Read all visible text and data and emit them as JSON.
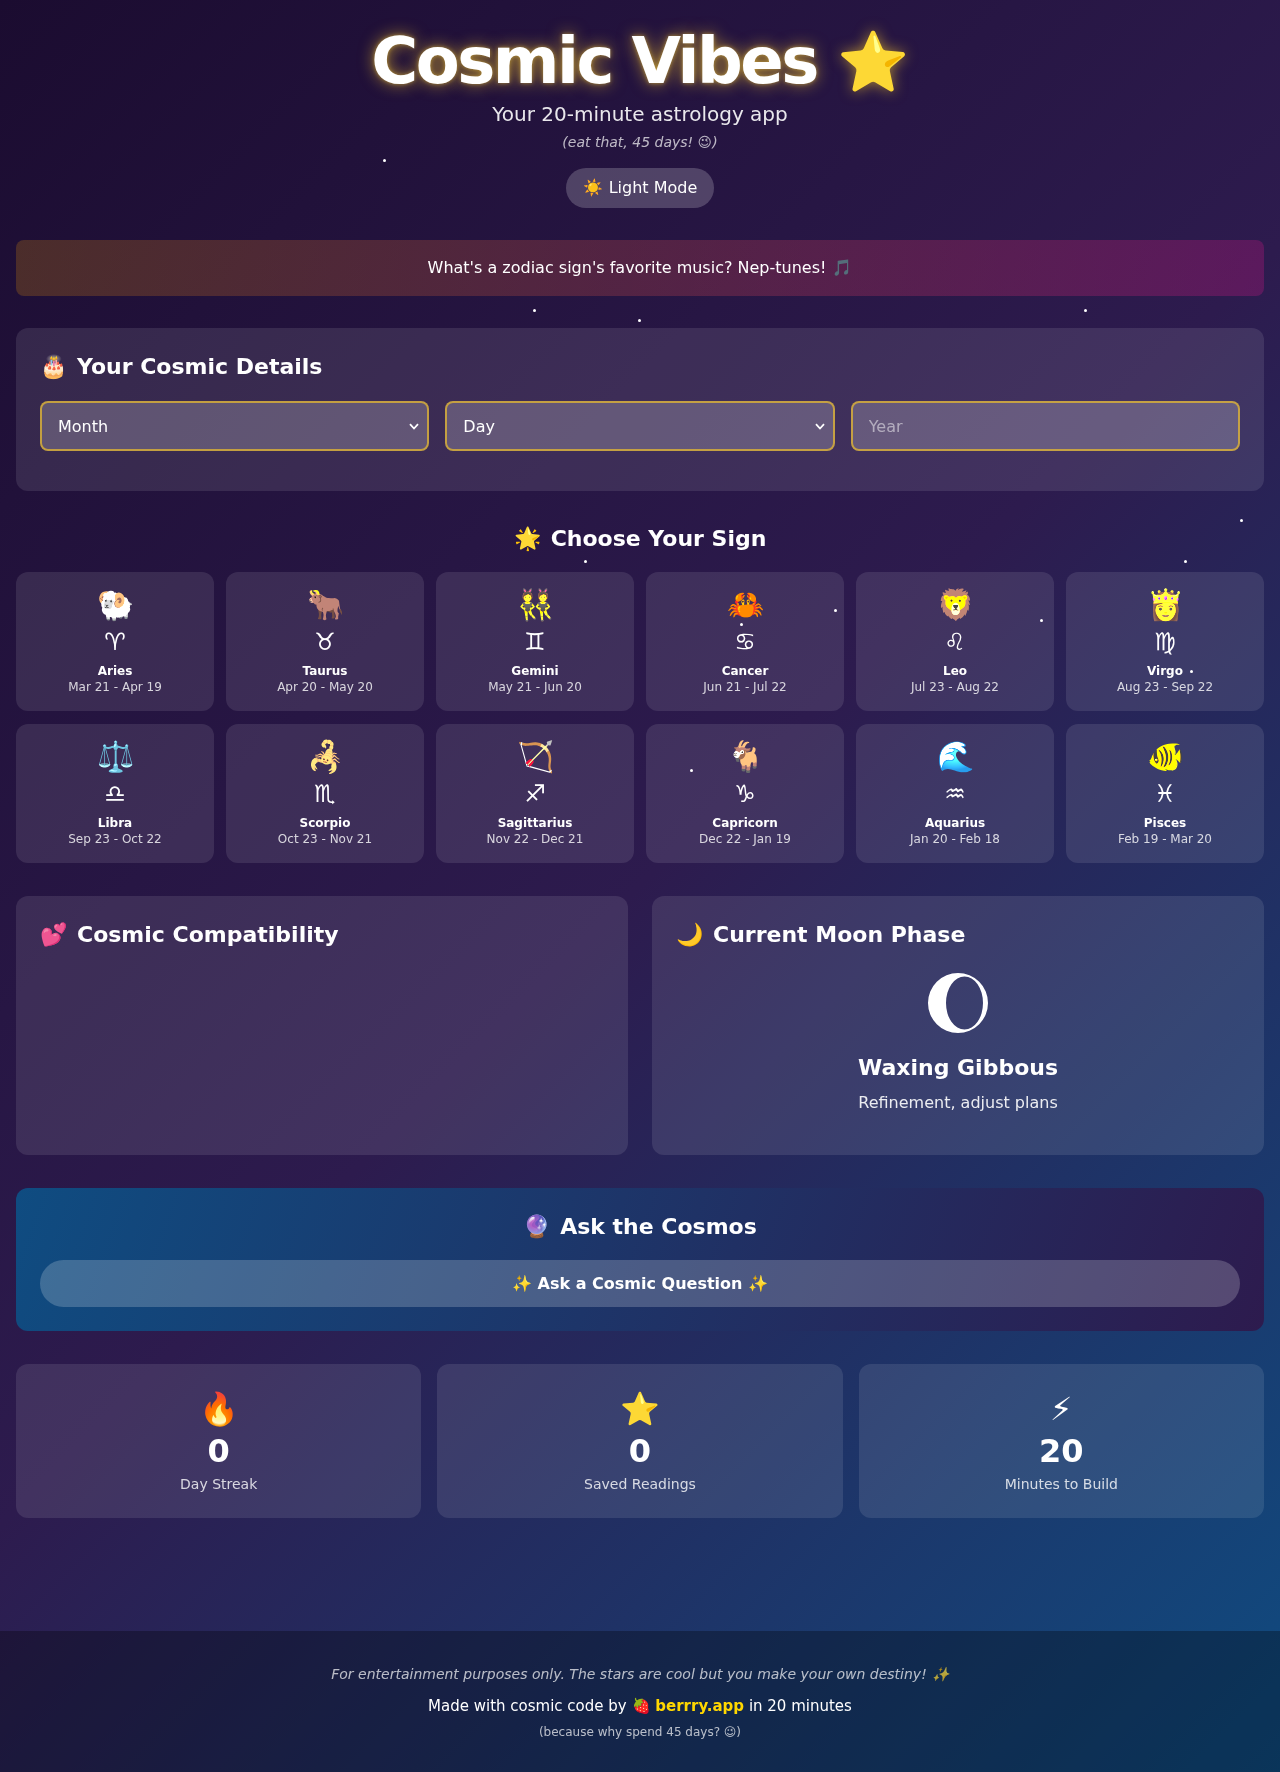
{
  "header": {
    "title": "Cosmic Vibes",
    "title_icon": "⭐",
    "subtitle": "Your 20-minute astrology app",
    "tagline": "(eat that, 45 days! 😉)",
    "theme_button": {
      "icon": "☀️",
      "label": "Light Mode"
    }
  },
  "joke": {
    "text": "What's a zodiac sign's favorite music? Nep-tunes!",
    "icon": "🎵"
  },
  "details": {
    "icon": "🎂",
    "title": "Your Cosmic Details",
    "fields": [
      {
        "kind": "select",
        "value": "Month"
      },
      {
        "kind": "select",
        "value": "Day"
      },
      {
        "kind": "input",
        "placeholder": "Year"
      }
    ]
  },
  "signs": {
    "icon": "🌟",
    "title": "Choose Your Sign",
    "items": [
      {
        "emoji": "🐏",
        "symbol": "♈",
        "name": "Aries",
        "dates": "Mar 21 - Apr 19",
        "selected": false
      },
      {
        "emoji": "🐂",
        "symbol": "♉",
        "name": "Taurus",
        "dates": "Apr 20 - May 20",
        "selected": false
      },
      {
        "emoji": "👯",
        "symbol": "♊",
        "name": "Gemini",
        "dates": "May 21 - Jun 20",
        "selected": false
      },
      {
        "emoji": "🦀",
        "symbol": "♋",
        "name": "Cancer",
        "dates": "Jun 21 - Jul 22",
        "selected": false
      },
      {
        "emoji": "🦁",
        "symbol": "♌",
        "name": "Leo",
        "dates": "Jul 23 - Aug 22",
        "selected": false
      },
      {
        "emoji": "👸",
        "symbol": "♍",
        "name": "Virgo",
        "dates": "Aug 23 - Sep 22",
        "selected": false
      },
      {
        "emoji": "⚖️",
        "symbol": "♎",
        "name": "Libra",
        "dates": "Sep 23 - Oct 22",
        "selected": false
      },
      {
        "emoji": "🦂",
        "symbol": "♏",
        "name": "Scorpio",
        "dates": "Oct 23 - Nov 21",
        "selected": false
      },
      {
        "emoji": "🏹",
        "symbol": "♐",
        "name": "Sagittarius",
        "dates": "Nov 22 - Dec 21",
        "selected": false
      },
      {
        "emoji": "🐐",
        "symbol": "♑",
        "name": "Capricorn",
        "dates": "Dec 22 - Jan 19",
        "selected": false
      },
      {
        "emoji": "🌊",
        "symbol": "♒",
        "name": "Aquarius",
        "dates": "Jan 20 - Feb 18",
        "selected": false
      },
      {
        "emoji": "🐠",
        "symbol": "♓",
        "name": "Pisces",
        "dates": "Feb 19 - Mar 20",
        "selected": false
      }
    ]
  },
  "compatibility": {
    "icon": "💕",
    "title": "Cosmic Compatibility"
  },
  "moon": {
    "icon": "🌙",
    "title": "Current Moon Phase",
    "phase": "Waxing Gibbous",
    "meaning": "Refinement, adjust plans"
  },
  "ask": {
    "icon": "🔮",
    "title": "Ask the Cosmos",
    "button": {
      "icon_left": "✨",
      "label": "Ask a Cosmic Question",
      "icon_right": "✨"
    }
  },
  "stats": [
    {
      "icon": "🔥",
      "value": "0",
      "label": "Day Streak"
    },
    {
      "icon": "⭐",
      "value": "0",
      "label": "Saved Readings"
    },
    {
      "icon": "⚡",
      "value": "20",
      "label": "Minutes to Build"
    }
  ],
  "footer": {
    "disclaimer": {
      "text": "For entertainment purposes only. The stars are cool but you make your own destiny!",
      "icon": "✨"
    },
    "credit": {
      "before": "Made with cosmic code by",
      "icon": "🍓",
      "link": "berrry.app",
      "after": "in 20 minutes"
    },
    "note": "(because why spend 45 days? 😉)"
  }
}
